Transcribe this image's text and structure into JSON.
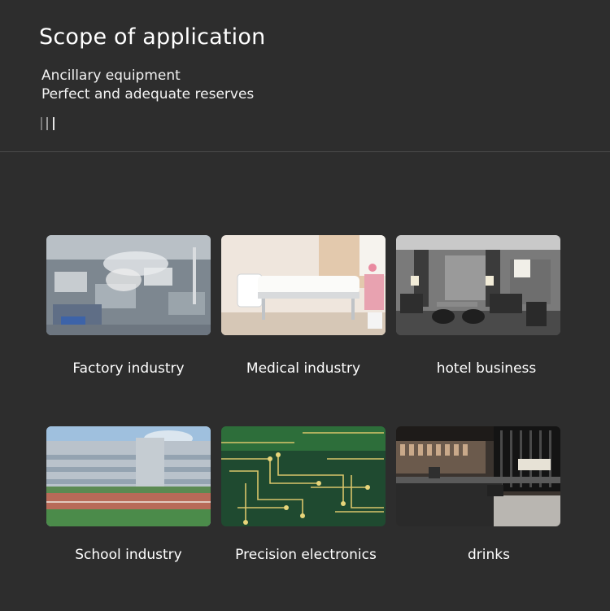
{
  "header": {
    "title": "Scope of application",
    "line1": "Ancillary equipment",
    "line2": "Perfect and adequate reserves",
    "bar_colors": [
      "#777777",
      "#9a9a9a",
      "#e6e6e6"
    ]
  },
  "tiles": [
    {
      "label": "Factory industry",
      "icon": "factory-photo"
    },
    {
      "label": "Medical industry",
      "icon": "hospital-room-photo"
    },
    {
      "label": "hotel business",
      "icon": "hotel-lobby-photo"
    },
    {
      "label": "School industry",
      "icon": "school-building-photo"
    },
    {
      "label": "Precision electronics",
      "icon": "circuit-board-photo"
    },
    {
      "label": "drinks",
      "icon": "bar-counter-photo"
    }
  ]
}
